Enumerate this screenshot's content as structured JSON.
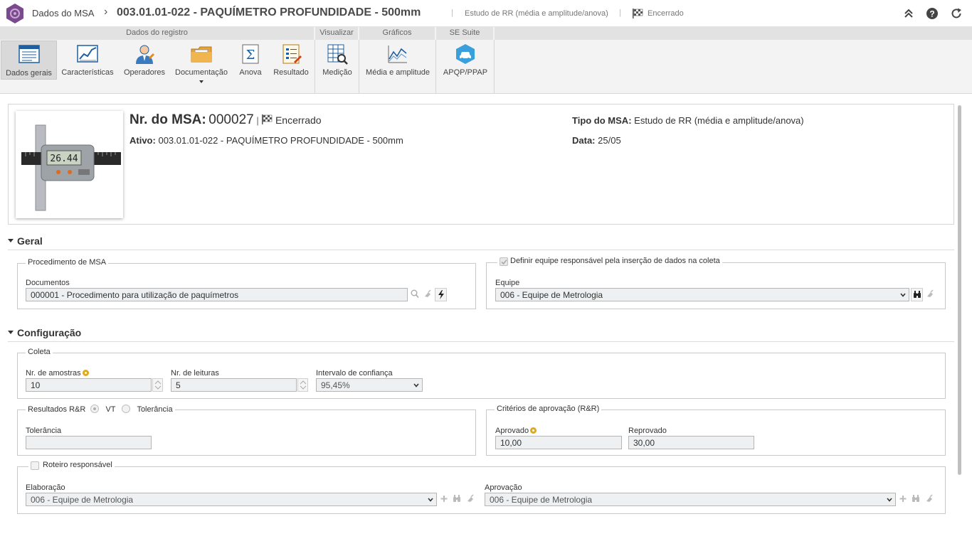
{
  "topbar": {
    "breadcrumb_root": "Dados do MSA",
    "chevron": "›",
    "title": "003.01.01-022 - PAQUÍMETRO PROFUNDIDADE - 500mm",
    "study_type": "Estudo de RR (média e amplitude/anova)",
    "status": "Encerrado",
    "icons": [
      "collapse-icon",
      "help-icon",
      "refresh-icon"
    ]
  },
  "ribbon": {
    "groups": [
      {
        "label": "Dados do registro"
      },
      {
        "label": "Visualizar"
      },
      {
        "label": "Gráficos"
      },
      {
        "label": "SE Suite"
      }
    ],
    "buttons": {
      "dados_gerais": "Dados gerais",
      "caracteristicas": "Características",
      "operadores": "Operadores",
      "documentacao": "Documentação",
      "anova": "Anova",
      "resultado": "Resultado",
      "medicao": "Medição",
      "media_amplitude": "Média e amplitude",
      "apqp": "APQP/PPAP"
    }
  },
  "header": {
    "nr_label": "Nr. do MSA:",
    "nr_value": "000027",
    "divider": "|",
    "status": "Encerrado",
    "ativo_label": "Ativo:",
    "ativo_value": "003.01.01-022 - PAQUÍMETRO PROFUNDIDADE - 500mm",
    "tipo_label": "Tipo do MSA:",
    "tipo_value": "Estudo de RR (média e amplitude/anova)",
    "data_label": "Data:",
    "data_value": "25/05",
    "caliper_reading": "26.44"
  },
  "geral": {
    "title": "Geral",
    "procedimento": {
      "legend": "Procedimento de MSA",
      "documentos_label": "Documentos",
      "documentos_value": "000001 - Procedimento para utilização de paquímetros"
    },
    "equipe_box": {
      "checkbox_label": "Definir equipe responsável pela inserção de dados na coleta",
      "equipe_label": "Equipe",
      "equipe_value": "006 - Equipe de Metrologia"
    }
  },
  "configuracao": {
    "title": "Configuração",
    "coleta": {
      "legend": "Coleta",
      "amostras_label": "Nr. de amostras",
      "amostras_value": "10",
      "leituras_label": "Nr. de leituras",
      "leituras_value": "5",
      "intervalo_label": "Intervalo de confiança",
      "intervalo_value": "95,45%"
    },
    "resultados": {
      "legend": "Resultados R&R",
      "opt_vt": "VT",
      "opt_tol": "Tolerância",
      "tolerancia_label": "Tolerância",
      "tolerancia_value": ""
    },
    "criterios": {
      "legend": "Critérios de aprovação (R&R)",
      "aprovado_label": "Aprovado",
      "aprovado_value": "10,00",
      "reprovado_label": "Reprovado",
      "reprovado_value": "30,00"
    },
    "roteiro": {
      "legend": "Roteiro responsável",
      "elaboracao_label": "Elaboração",
      "elaboracao_value": "006 - Equipe de Metrologia",
      "aprovacao_label": "Aprovação",
      "aprovacao_value": "006 - Equipe de Metrologia"
    }
  },
  "colors": {
    "accent_logo": "#7b4a8e",
    "ribbon_bg": "#f3f3f3",
    "tab_bg": "#e2e2e2",
    "required": "#e0a81a",
    "apqp_blue": "#3aa0dc"
  }
}
